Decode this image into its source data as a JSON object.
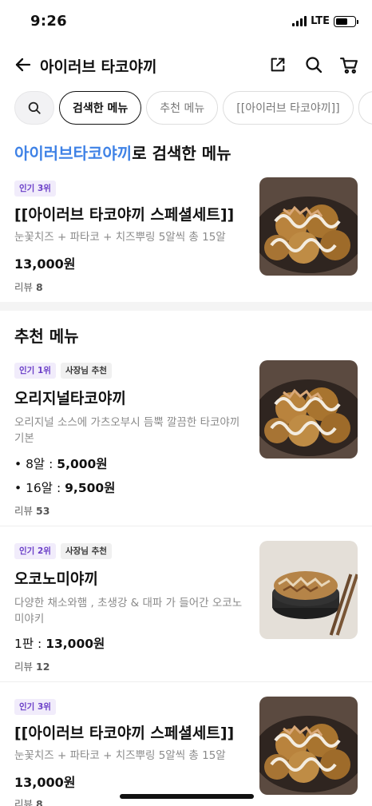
{
  "status_bar": {
    "time": "9:26",
    "network": "LTE",
    "battery_level": 0.65
  },
  "header": {
    "title": "아이러브 타코야끼",
    "icons": [
      "back-arrow-icon",
      "share-icon",
      "search-icon",
      "cart-icon"
    ]
  },
  "chips": [
    {
      "label": "검색한 메뉴",
      "active": true
    },
    {
      "label": "추천 메뉴",
      "active": false
    },
    {
      "label": "[[아이러브 타코야끼]]",
      "active": false
    }
  ],
  "search_section": {
    "keyword": "아이러브타코야끼",
    "suffix": "로 검색한 메뉴"
  },
  "search_results": [
    {
      "badge": "인기 3위",
      "name": "[[아이러브 타코야끼 스페셜세트]]",
      "description": "눈꽃치즈 + 파타코 + 치즈뿌링 5알씩 총 15알",
      "price": "13,000원",
      "review_label": "리뷰",
      "review_count": "8"
    }
  ],
  "recommend_section": {
    "title": "추천 메뉴"
  },
  "recommended": [
    {
      "badge": "인기 1위",
      "owner_badge": "사장님 추천",
      "name": "오리지널타코야끼",
      "description": "오리지널 소스에 가츠오부시 듬뿍 깔끔한 타코야끼 기본",
      "options": [
        {
          "label": "• 8알 : ",
          "price": "5,000원"
        },
        {
          "label": "• 16알 : ",
          "price": "9,500원"
        }
      ],
      "review_label": "리뷰",
      "review_count": "53"
    },
    {
      "badge": "인기 2위",
      "owner_badge": "사장님 추천",
      "name": "오코노미야끼",
      "description": "다양한 채소와햄 , 초생강 & 대파 가 들어간 오코노미야키",
      "option_label": "1판 : ",
      "price": "13,000원",
      "review_label": "리뷰",
      "review_count": "12"
    },
    {
      "badge": "인기 3위",
      "name": "[[아이러브 타코야끼 스페셜세트]]",
      "description": "눈꽃치즈 + 파타코 + 치즈뿌링 5알씩 총 15알",
      "price": "13,000원",
      "review_label": "리뷰",
      "review_count": "8"
    }
  ],
  "colors": {
    "keyword": "#3f82e6",
    "badge_pop_bg": "#f1ecfb",
    "badge_pop_text": "#6b3fc8"
  }
}
